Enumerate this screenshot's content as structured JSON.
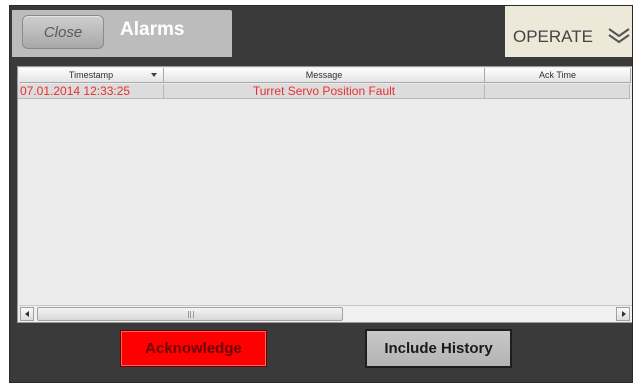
{
  "window": {
    "title": "Alarms"
  },
  "toolbar": {
    "close_label": "Close",
    "mode_label": "OPERATE",
    "mode_icon": "chevron-double-down-icon"
  },
  "table": {
    "columns": [
      "Timestamp",
      "Message",
      "Ack Time"
    ],
    "rows": [
      {
        "timestamp": "07.01.2014 12:33:25",
        "message": "Turret Servo Position Fault",
        "ack_time": ""
      }
    ]
  },
  "buttons": {
    "acknowledge_label": "Acknowledge",
    "include_history_label": "Include History"
  },
  "colors": {
    "alarm_text": "#e8302e",
    "acknowledge_bg": "#ff0000",
    "frame_bg": "#3a3a3a"
  }
}
